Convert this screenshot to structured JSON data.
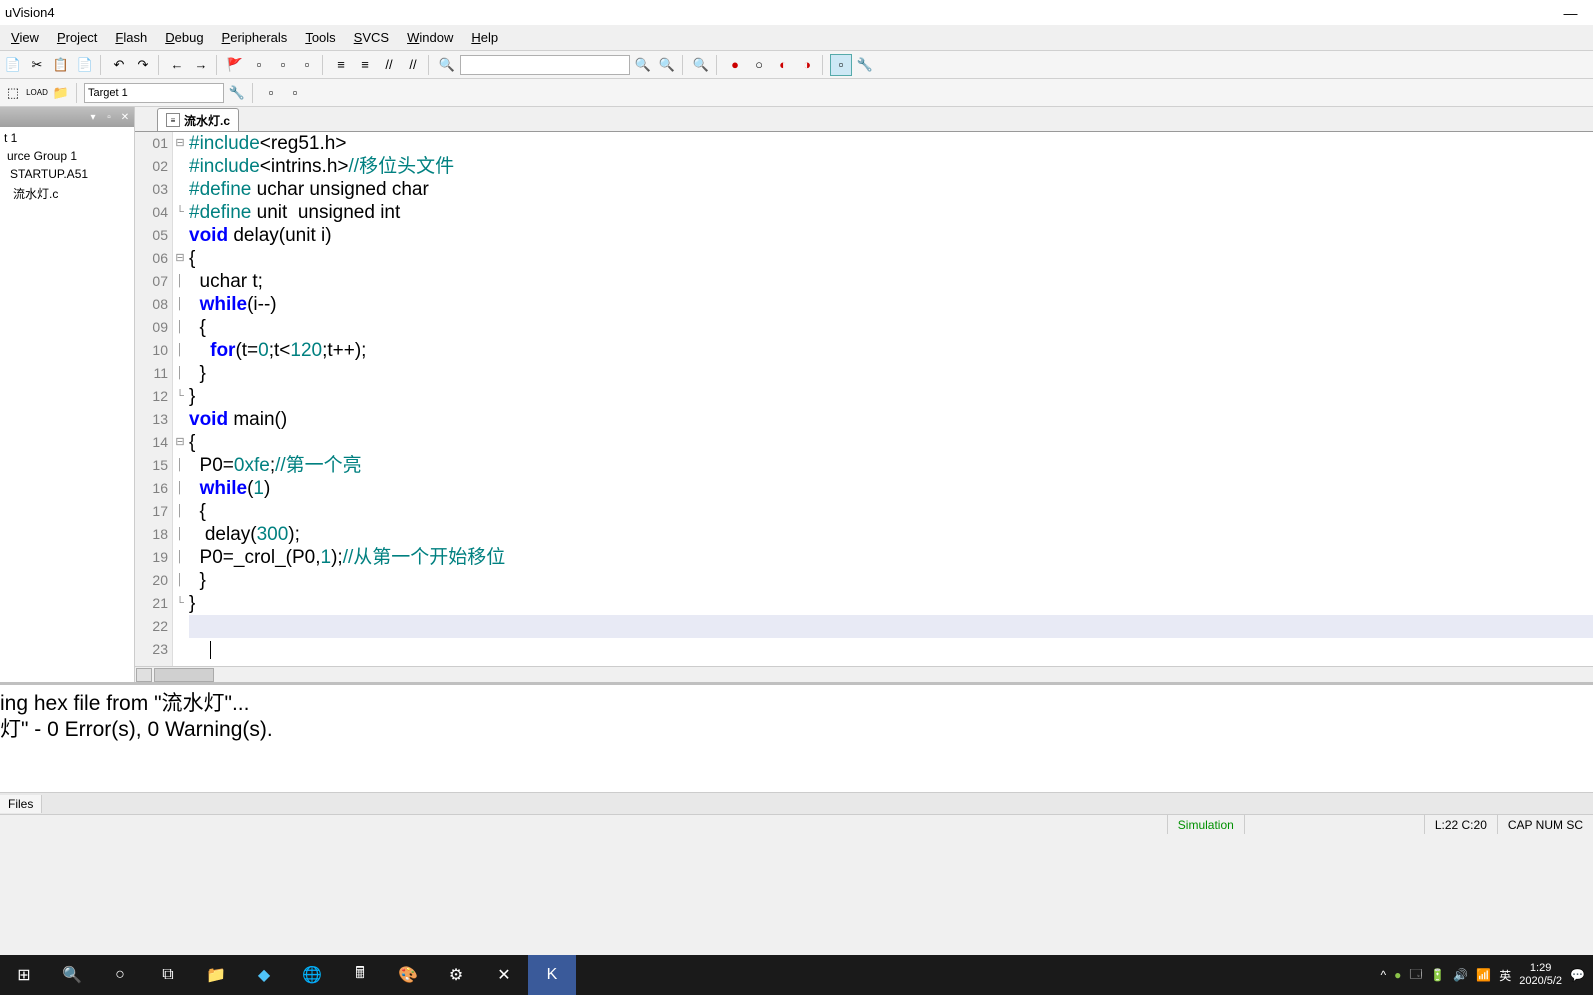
{
  "title": "uVision4",
  "menus": [
    "View",
    "Project",
    "Flash",
    "Debug",
    "Peripherals",
    "Tools",
    "SVCS",
    "Window",
    "Help"
  ],
  "target": "Target 1",
  "project_tree": [
    "t 1",
    "urce Group 1",
    "STARTUP.A51",
    "流水灯.c"
  ],
  "tab": {
    "filename": "流水灯.c"
  },
  "code": {
    "lines": [
      {
        "n": "01",
        "fold": "⊟",
        "segs": [
          {
            "c": "pp",
            "t": "#include"
          },
          {
            "c": "txt",
            "t": "<reg51.h>"
          }
        ]
      },
      {
        "n": "02",
        "fold": "",
        "segs": [
          {
            "c": "pp",
            "t": "#include"
          },
          {
            "c": "txt",
            "t": "<intrins.h>"
          },
          {
            "c": "cm",
            "t": "//移位头文件"
          }
        ]
      },
      {
        "n": "03",
        "fold": "",
        "segs": [
          {
            "c": "pp",
            "t": "#define"
          },
          {
            "c": "txt",
            "t": " uchar unsigned char"
          }
        ]
      },
      {
        "n": "04",
        "fold": "└",
        "segs": [
          {
            "c": "pp",
            "t": "#define"
          },
          {
            "c": "txt",
            "t": " unit  unsigned int"
          }
        ]
      },
      {
        "n": "05",
        "fold": "",
        "segs": [
          {
            "c": "kw",
            "t": "void"
          },
          {
            "c": "txt",
            "t": " delay(unit i)"
          }
        ]
      },
      {
        "n": "06",
        "fold": "⊟",
        "segs": [
          {
            "c": "txt",
            "t": "{"
          }
        ]
      },
      {
        "n": "07",
        "fold": "│",
        "segs": [
          {
            "c": "txt",
            "t": "  uchar t;"
          }
        ]
      },
      {
        "n": "08",
        "fold": "│",
        "segs": [
          {
            "c": "txt",
            "t": "  "
          },
          {
            "c": "kw",
            "t": "while"
          },
          {
            "c": "txt",
            "t": "(i--)"
          }
        ]
      },
      {
        "n": "09",
        "fold": "│",
        "segs": [
          {
            "c": "txt",
            "t": "  {"
          }
        ]
      },
      {
        "n": "10",
        "fold": "│",
        "segs": [
          {
            "c": "txt",
            "t": "    "
          },
          {
            "c": "kw",
            "t": "for"
          },
          {
            "c": "txt",
            "t": "(t="
          },
          {
            "c": "num",
            "t": "0"
          },
          {
            "c": "txt",
            "t": ";t<"
          },
          {
            "c": "num",
            "t": "120"
          },
          {
            "c": "txt",
            "t": ";t++);"
          }
        ]
      },
      {
        "n": "11",
        "fold": "│",
        "segs": [
          {
            "c": "txt",
            "t": "  }"
          }
        ]
      },
      {
        "n": "12",
        "fold": "└",
        "segs": [
          {
            "c": "txt",
            "t": "}"
          }
        ]
      },
      {
        "n": "13",
        "fold": "",
        "segs": [
          {
            "c": "kw",
            "t": "void"
          },
          {
            "c": "txt",
            "t": " main()"
          }
        ]
      },
      {
        "n": "14",
        "fold": "⊟",
        "segs": [
          {
            "c": "txt",
            "t": "{"
          }
        ]
      },
      {
        "n": "15",
        "fold": "│",
        "segs": [
          {
            "c": "txt",
            "t": "  P0="
          },
          {
            "c": "num",
            "t": "0xfe"
          },
          {
            "c": "txt",
            "t": ";"
          },
          {
            "c": "cm",
            "t": "//第一个亮"
          }
        ]
      },
      {
        "n": "16",
        "fold": "│",
        "segs": [
          {
            "c": "txt",
            "t": "  "
          },
          {
            "c": "kw",
            "t": "while"
          },
          {
            "c": "txt",
            "t": "("
          },
          {
            "c": "num",
            "t": "1"
          },
          {
            "c": "txt",
            "t": ")"
          }
        ]
      },
      {
        "n": "17",
        "fold": "│",
        "segs": [
          {
            "c": "txt",
            "t": "  {"
          }
        ]
      },
      {
        "n": "18",
        "fold": "│",
        "segs": [
          {
            "c": "txt",
            "t": "   delay("
          },
          {
            "c": "num",
            "t": "300"
          },
          {
            "c": "txt",
            "t": ");"
          }
        ]
      },
      {
        "n": "19",
        "fold": "│",
        "segs": [
          {
            "c": "txt",
            "t": "  P0=_crol_(P0,"
          },
          {
            "c": "num",
            "t": "1"
          },
          {
            "c": "txt",
            "t": ");"
          },
          {
            "c": "cm",
            "t": "//从第一个开始移位"
          }
        ]
      },
      {
        "n": "20",
        "fold": "│",
        "segs": [
          {
            "c": "txt",
            "t": "  }"
          }
        ]
      },
      {
        "n": "21",
        "fold": "└",
        "segs": [
          {
            "c": "txt",
            "t": "}"
          }
        ]
      },
      {
        "n": "22",
        "fold": "",
        "segs": [
          {
            "c": "txt",
            "t": ""
          }
        ],
        "hl": true
      },
      {
        "n": "23",
        "fold": "",
        "segs": [
          {
            "c": "txt",
            "t": "    "
          }
        ],
        "caret": true
      }
    ]
  },
  "build_output": [
    "ing hex file from \"流水灯\"...",
    "灯\" - 0 Error(s), 0 Warning(s)."
  ],
  "output_tab": "Files",
  "status": {
    "sim": "Simulation",
    "pos": "L:22 C:20",
    "ind": "CAP  NUM  SC"
  },
  "tray": {
    "ime": "英",
    "time": "1:29",
    "date": "2020/5/2"
  }
}
